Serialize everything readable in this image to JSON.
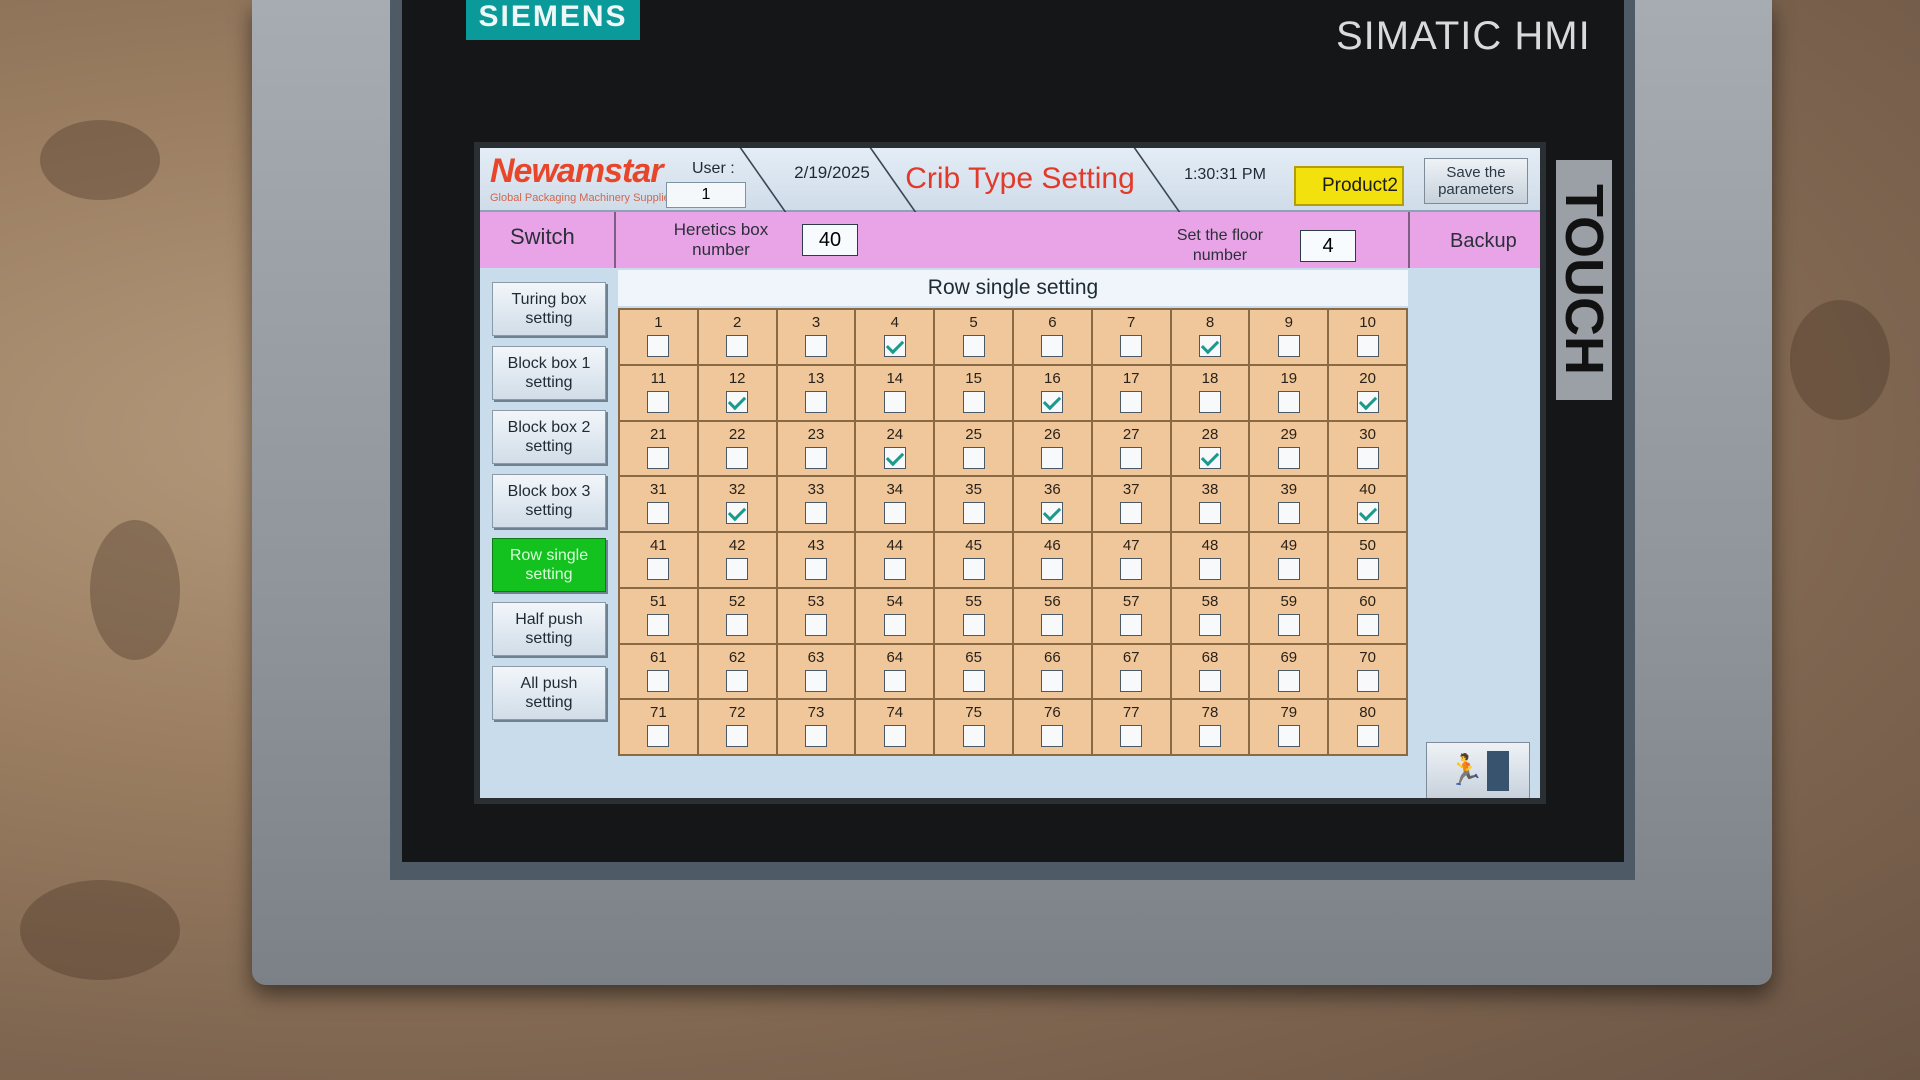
{
  "device": {
    "brand": "SIEMENS",
    "model": "SIMATIC HMI",
    "side_label": "TOUCH"
  },
  "header": {
    "logo": "Newamstar",
    "logo_sub": "Global Packaging Machinery Supplier",
    "user_label": "User :",
    "user_value": "1",
    "date": "2/19/2025",
    "title": "Crib Type Setting",
    "time": "1:30:31 PM",
    "product": "Product2",
    "save_label": "Save the parameters"
  },
  "bar": {
    "switch": "Switch",
    "heretics_label": "Heretics box number",
    "heretics_value": "40",
    "floor_label": "Set the floor number",
    "floor_value": "4",
    "backup": "Backup"
  },
  "sidebar": {
    "items": [
      {
        "label": "Turing box setting",
        "active": false
      },
      {
        "label": "Block box 1 setting",
        "active": false
      },
      {
        "label": "Block box 2 setting",
        "active": false
      },
      {
        "label": "Block box 3 setting",
        "active": false
      },
      {
        "label": "Row single setting",
        "active": true
      },
      {
        "label": "Half push setting",
        "active": false
      },
      {
        "label": "All push setting",
        "active": false
      }
    ]
  },
  "grid": {
    "title": "Row single setting",
    "cells": [
      {
        "n": "1",
        "c": false
      },
      {
        "n": "2",
        "c": false
      },
      {
        "n": "3",
        "c": false
      },
      {
        "n": "4",
        "c": true
      },
      {
        "n": "5",
        "c": false
      },
      {
        "n": "6",
        "c": false
      },
      {
        "n": "7",
        "c": false
      },
      {
        "n": "8",
        "c": true
      },
      {
        "n": "9",
        "c": false
      },
      {
        "n": "10",
        "c": false
      },
      {
        "n": "11",
        "c": false
      },
      {
        "n": "12",
        "c": true
      },
      {
        "n": "13",
        "c": false
      },
      {
        "n": "14",
        "c": false
      },
      {
        "n": "15",
        "c": false
      },
      {
        "n": "16",
        "c": true
      },
      {
        "n": "17",
        "c": false
      },
      {
        "n": "18",
        "c": false
      },
      {
        "n": "19",
        "c": false
      },
      {
        "n": "20",
        "c": true
      },
      {
        "n": "21",
        "c": false
      },
      {
        "n": "22",
        "c": false
      },
      {
        "n": "23",
        "c": false
      },
      {
        "n": "24",
        "c": true
      },
      {
        "n": "25",
        "c": false
      },
      {
        "n": "26",
        "c": false
      },
      {
        "n": "27",
        "c": false
      },
      {
        "n": "28",
        "c": true
      },
      {
        "n": "29",
        "c": false
      },
      {
        "n": "30",
        "c": false
      },
      {
        "n": "31",
        "c": false
      },
      {
        "n": "32",
        "c": true
      },
      {
        "n": "33",
        "c": false
      },
      {
        "n": "34",
        "c": false
      },
      {
        "n": "35",
        "c": false
      },
      {
        "n": "36",
        "c": true
      },
      {
        "n": "37",
        "c": false
      },
      {
        "n": "38",
        "c": false
      },
      {
        "n": "39",
        "c": false
      },
      {
        "n": "40",
        "c": true
      },
      {
        "n": "41",
        "c": false
      },
      {
        "n": "42",
        "c": false
      },
      {
        "n": "43",
        "c": false
      },
      {
        "n": "44",
        "c": false
      },
      {
        "n": "45",
        "c": false
      },
      {
        "n": "46",
        "c": false
      },
      {
        "n": "47",
        "c": false
      },
      {
        "n": "48",
        "c": false
      },
      {
        "n": "49",
        "c": false
      },
      {
        "n": "50",
        "c": false
      },
      {
        "n": "51",
        "c": false
      },
      {
        "n": "52",
        "c": false
      },
      {
        "n": "53",
        "c": false
      },
      {
        "n": "54",
        "c": false
      },
      {
        "n": "55",
        "c": false
      },
      {
        "n": "56",
        "c": false
      },
      {
        "n": "57",
        "c": false
      },
      {
        "n": "58",
        "c": false
      },
      {
        "n": "59",
        "c": false
      },
      {
        "n": "60",
        "c": false
      },
      {
        "n": "61",
        "c": false
      },
      {
        "n": "62",
        "c": false
      },
      {
        "n": "63",
        "c": false
      },
      {
        "n": "64",
        "c": false
      },
      {
        "n": "65",
        "c": false
      },
      {
        "n": "66",
        "c": false
      },
      {
        "n": "67",
        "c": false
      },
      {
        "n": "68",
        "c": false
      },
      {
        "n": "69",
        "c": false
      },
      {
        "n": "70",
        "c": false
      },
      {
        "n": "71",
        "c": false
      },
      {
        "n": "72",
        "c": false
      },
      {
        "n": "73",
        "c": false
      },
      {
        "n": "74",
        "c": false
      },
      {
        "n": "75",
        "c": false
      },
      {
        "n": "76",
        "c": false
      },
      {
        "n": "77",
        "c": false
      },
      {
        "n": "78",
        "c": false
      },
      {
        "n": "79",
        "c": false
      },
      {
        "n": "80",
        "c": false
      }
    ]
  },
  "exit": {
    "icon": "exit-icon"
  },
  "colors": {
    "accent_active": "#13c21f",
    "product_yellow": "#f3e10e",
    "title_red": "#e2392a",
    "grid_bg": "#f0c79a",
    "bar_pink": "#e8a4e6"
  }
}
